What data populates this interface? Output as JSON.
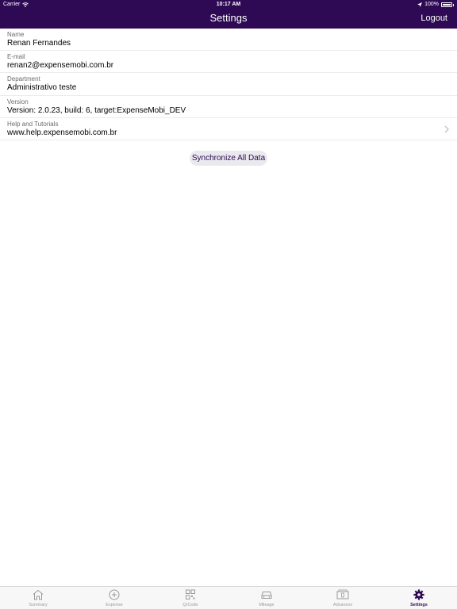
{
  "status_bar": {
    "carrier": "Carrier",
    "time": "10:17 AM",
    "battery": "100%"
  },
  "nav": {
    "title": "Settings",
    "logout_label": "Logout"
  },
  "rows": [
    {
      "label": "Name",
      "value": "Renan Fernandes"
    },
    {
      "label": "E-mail",
      "value": "renan2@expensemobi.com.br"
    },
    {
      "label": "Department",
      "value": "Administrativo teste"
    },
    {
      "label": "Version",
      "value": "Version: 2.0.23, build: 6, target:ExpenseMobi_DEV"
    },
    {
      "label": "Help and Tutorials",
      "value": "www.help.expensemobi.com.br"
    }
  ],
  "sync_button_label": "Synchronize All Data",
  "tabs": [
    {
      "label": "Summary",
      "icon": "home-icon"
    },
    {
      "label": "Expense",
      "icon": "plus-circle-icon"
    },
    {
      "label": "QrCode",
      "icon": "qrcode-icon"
    },
    {
      "label": "Mileage",
      "icon": "car-icon"
    },
    {
      "label": "Advances",
      "icon": "cash-icon"
    },
    {
      "label": "Settings",
      "icon": "gear-icon"
    }
  ],
  "active_tab": "Settings",
  "colors": {
    "brand": "#2e0a54",
    "tab_inactive": "#9a9a9a",
    "button_bg": "#e9e9ee"
  }
}
